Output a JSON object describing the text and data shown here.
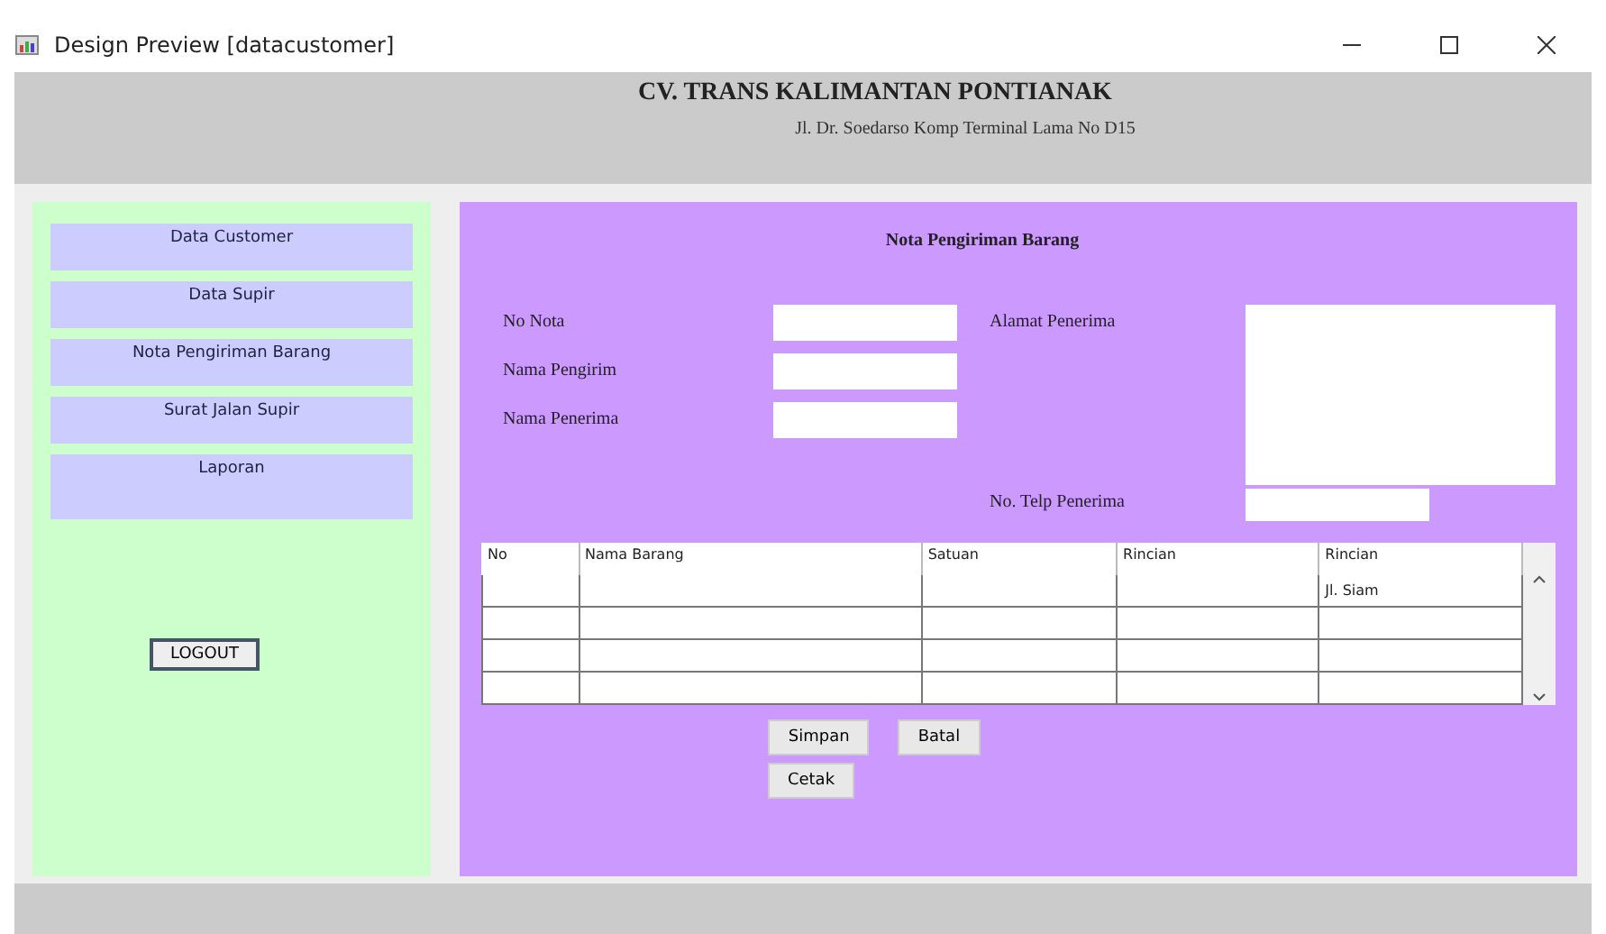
{
  "window": {
    "title": "Design Preview [datacustomer]"
  },
  "header": {
    "company": "CV. TRANS KALIMANTAN PONTIANAK",
    "address": "Jl. Dr. Soedarso Komp Terminal Lama No D15"
  },
  "sidebar": {
    "items": [
      "Data Customer",
      "Data Supir",
      "Nota Pengiriman Barang",
      "Surat Jalan Supir",
      "Laporan"
    ],
    "logout": "LOGOUT"
  },
  "form": {
    "title": "Nota Pengiriman Barang",
    "fields": [
      {
        "label": "No Nota"
      },
      {
        "label": "Nama Pengirim"
      },
      {
        "label": "Nama Penerima"
      }
    ],
    "address_label": "Alamat Penerima",
    "phone_label": "No. Telp Penerima"
  },
  "table": {
    "columns": [
      "No",
      "Nama Barang",
      "Satuan",
      "Rincian",
      "Rincian"
    ],
    "rows": [
      [
        "",
        "",
        "",
        "",
        "Jl. Siam"
      ],
      [
        "",
        "",
        "",
        "",
        ""
      ],
      [
        "",
        "",
        "",
        "",
        ""
      ],
      [
        "",
        "",
        "",
        "",
        ""
      ]
    ]
  },
  "buttons": {
    "row": [
      "Simpan",
      "Batal"
    ],
    "print": "Cetak"
  }
}
